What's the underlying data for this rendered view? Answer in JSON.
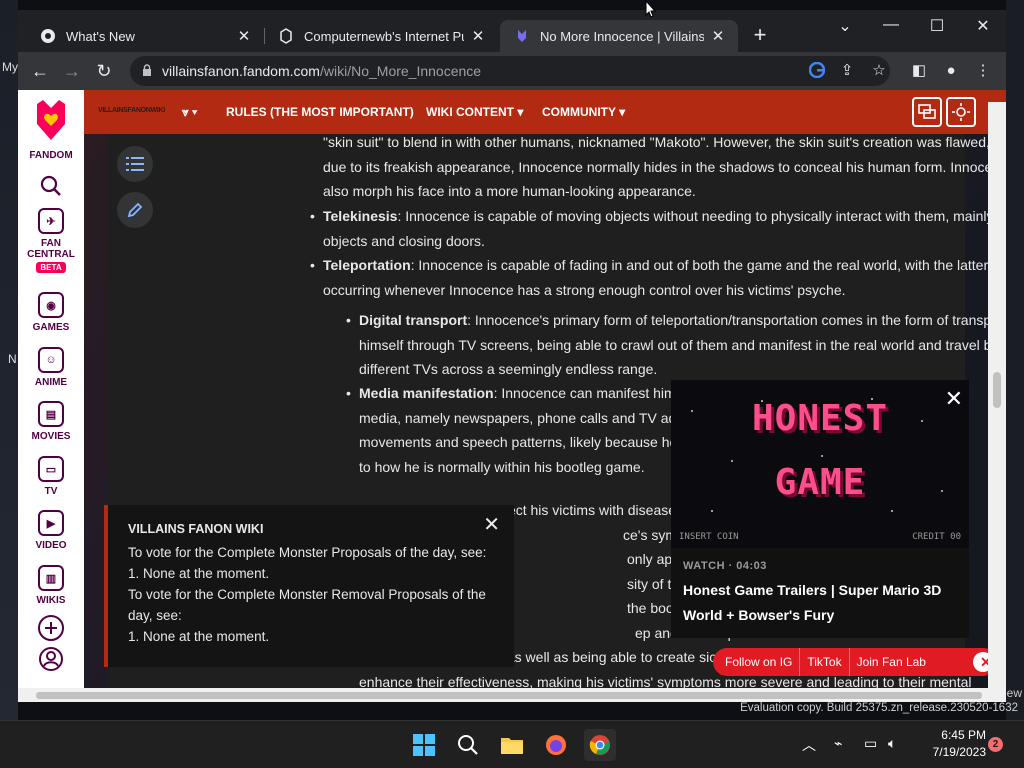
{
  "desktop": {
    "left_text_top": "My",
    "left_text_mid": "N",
    "right_text": "ew"
  },
  "tabs": [
    {
      "title": "What's New",
      "favicon": "chrome-icon"
    },
    {
      "title": "Computernewb's Internet Pub H",
      "favicon": "computernewb-icon"
    },
    {
      "title": "No More Innocence | Villains Fa",
      "favicon": "fandom-icon",
      "active": true
    }
  ],
  "address": {
    "host": "villainsfanon.fandom.com",
    "path": "/wiki/No_More_Innocence"
  },
  "rail": {
    "logo_text": "FANDOM",
    "items": [
      {
        "label": "FAN CENTRAL",
        "badge": "BETA"
      },
      {
        "label": "GAMES"
      },
      {
        "label": "ANIME"
      },
      {
        "label": "MOVIES"
      },
      {
        "label": "TV"
      },
      {
        "label": "VIDEO"
      },
      {
        "label": "WIKIS"
      }
    ]
  },
  "wiki_header": {
    "logo": "VILLAINSFANONWIKI",
    "nav": [
      "RULES (THE MOST IMPORTANT)",
      "WIKI CONTENT",
      "COMMUNITY"
    ]
  },
  "article": {
    "intro": "\"skin suit\" to blend in with other humans, nicknamed \"Makoto\". However, the skin suit's creation was flawed, and due to its freakish appearance, Innocence normally hides in the shadows to conceal his human form. Innocence can also morph his face into a more human-looking appearance.",
    "telekinesis_term": "Telekinesis",
    "telekinesis_text": ": Innocence is capable of moving objects without needing to physically interact with them, mainly moving objects and closing doors.",
    "teleportation_term": "Teleportation",
    "teleportation_text": ": Innocence is capable of fading in and out of both the game and the real world, with the latter occurring whenever Innocence has a strong enough control over his victims' psyche.",
    "digital_term": "Digital transport",
    "digital_text": ": Innocence's primary form of teleportation/transportation comes in the form of transporting himself through TV screens, being able to crawl out of them and manifest in the real world and travel between different TVs across a seemingly endless range.",
    "media_term": "Media manifestation",
    "media_line1": ": Innocence can manifest himself in differe",
    "media_line2": "media, namely newspapers, phone calls and TV advertisements, a",
    "media_line3": "movements and speech patterns, likely because he isn't as powe",
    "media_line4": "to how he is normally within his bootleg game.",
    "vir_line1": "Virokinesis: Innocence can infect his victims with disease that preys o",
    "vir_line2": "ce's symptoms include",
    "vir_line3": "only appear several wee",
    "vir_line4": "sity of the symptoms, th",
    "vir_line5": "the bootleg game. Polic",
    "vir_line6": "ep and severe paranoia",
    "dis_line1": "Disease augmentation: As well as being able to create sicknesses, Inno",
    "dis_line2": "enhance their effectiveness, making his victims' symptoms more severe and leading to their mental"
  },
  "notice": {
    "title": "VILLAINS FANON WIKI",
    "line1": "To vote for the Complete Monster Proposals of the day, see:",
    "line2": "1. None at the moment.",
    "line3": "To vote for the Complete Monster Removal Proposals of the",
    "line4": "day, see:",
    "line5": "1. None at the moment."
  },
  "video": {
    "thumb_line1": "HONEST",
    "thumb_line2": "GAME",
    "insert_coin": "INSERT COIN",
    "credit": "CREDIT 00",
    "meta": "WATCH · 04:03",
    "title": "Honest Game Trailers | Super Mario 3D World + Bowser's Fury"
  },
  "social": {
    "items": [
      "Follow on IG",
      "TikTok",
      "Join Fan Lab"
    ]
  },
  "watermark": "Evaluation copy. Build 25375.zn_release.230520-1632",
  "clock": {
    "time": "6:45 PM",
    "date": "7/19/2023",
    "notifications": "2"
  },
  "colors": {
    "fandom_red": "#b32a12",
    "fandom_pink": "#fa005a",
    "video_pink": "#ff4f8b"
  }
}
